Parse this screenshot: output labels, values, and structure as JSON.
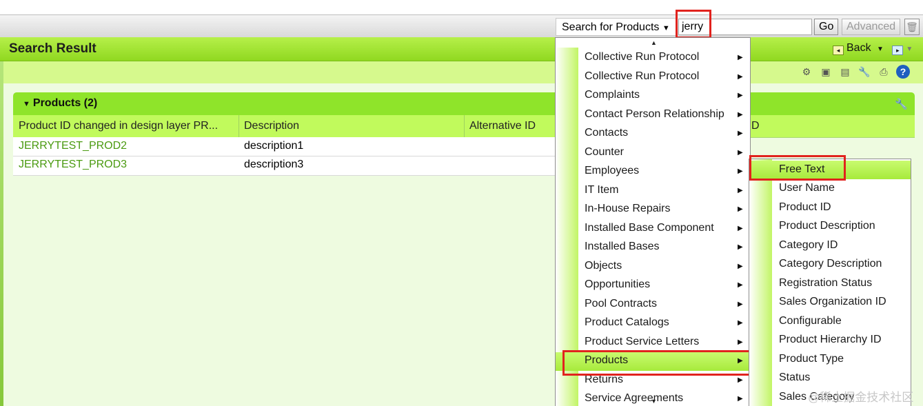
{
  "search": {
    "object_label": "Search for Products",
    "query_value": "jerry",
    "go_label": "Go",
    "advanced_label": "Advanced"
  },
  "page": {
    "title": "Search Result",
    "back_label": "Back"
  },
  "panel": {
    "title": "Products (2)",
    "columns": [
      "Product ID changed in design layer PR...",
      "Description",
      "Alternative ID",
      "D"
    ],
    "rows": [
      {
        "product_id": "JERRYTEST_PROD2",
        "description": "description1"
      },
      {
        "product_id": "JERRYTEST_PROD3",
        "description": "description3"
      }
    ]
  },
  "menu": {
    "items": [
      "Collective Run Protocol",
      "Collective Run Protocol",
      "Complaints",
      "Contact Person Relationship",
      "Contacts",
      "Counter",
      "Employees",
      "IT Item",
      "In-House Repairs",
      "Installed Base Component",
      "Installed Bases",
      "Objects",
      "Opportunities",
      "Pool Contracts",
      "Product Catalogs",
      "Product Service Letters",
      "Products",
      "Returns",
      "Service Agreements"
    ],
    "active_item": "Products"
  },
  "submenu": {
    "items": [
      "Free Text",
      "User Name",
      "Product ID",
      "Product Description",
      "Category ID",
      "Category Description",
      "Registration Status",
      "Sales Organization ID",
      "Configurable",
      "Product Hierarchy ID",
      "Product Type",
      "Status",
      "Sales Category"
    ],
    "active_item": "Free Text"
  },
  "watermark": "@稀土掘金技术社区",
  "icons": [
    "settings-icon",
    "personalize-icon",
    "print-preview-icon",
    "wrench-icon",
    "print-icon",
    "help-icon",
    "trash-icon"
  ],
  "colors": {
    "accent_green": "#8fe42a",
    "link_green": "#4a9a10",
    "highlight_red": "#e1231e"
  }
}
